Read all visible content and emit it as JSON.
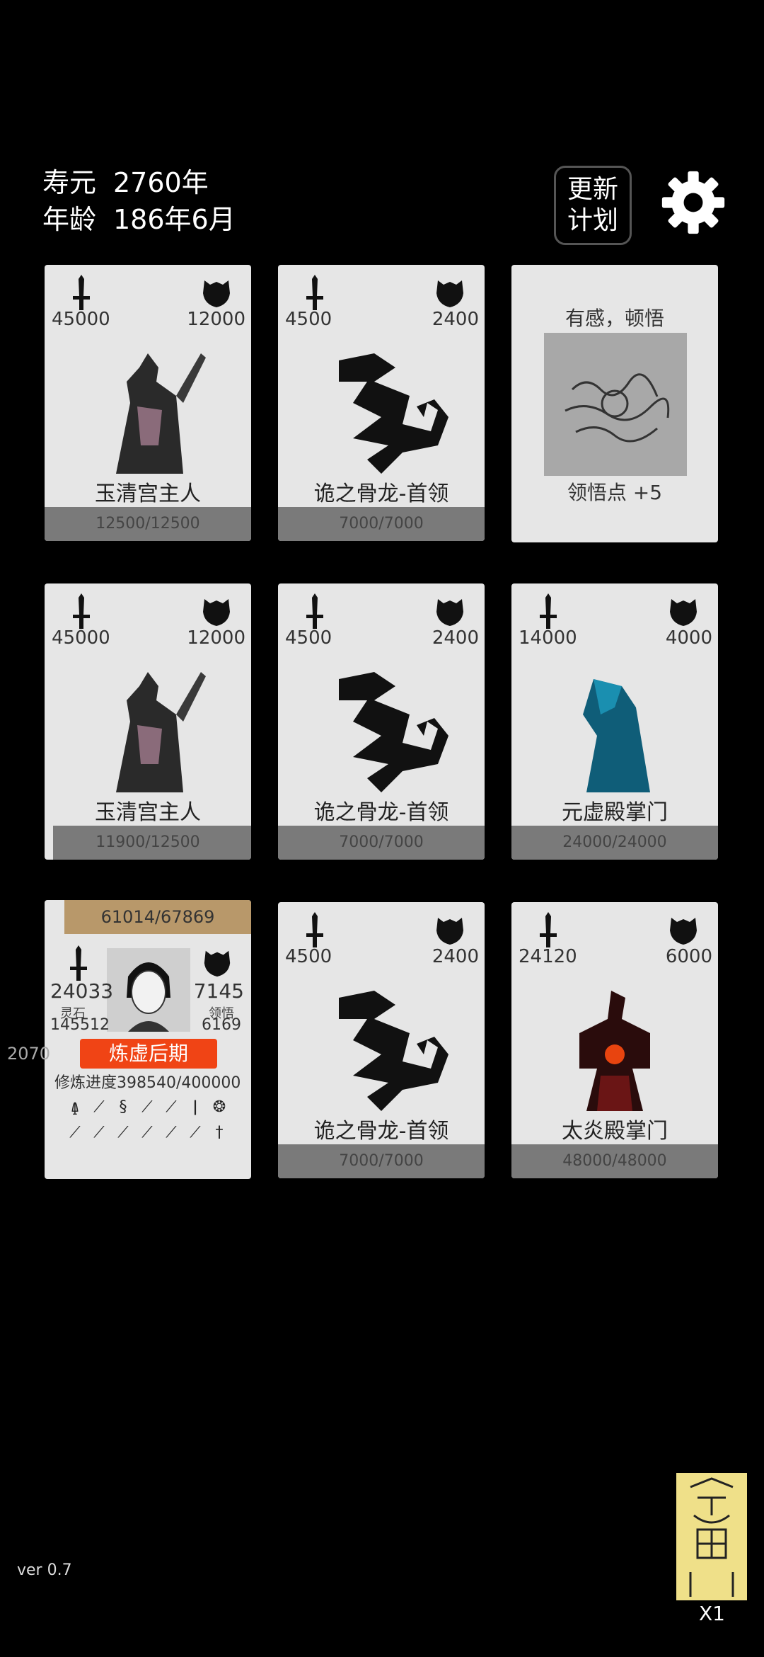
{
  "stats": {
    "lifespan_label": "寿元",
    "lifespan_value": "2760年",
    "age_label": "年龄",
    "age_value": "186年6月"
  },
  "buttons": {
    "update_plan_line1": "更新",
    "update_plan_line2": "计划"
  },
  "cards": [
    {
      "atk": "45000",
      "def": "12000",
      "name": "玉清宫主人",
      "hp": "12500/12500",
      "hp_fraction": 1.0,
      "art": "robed-master"
    },
    {
      "atk": "4500",
      "def": "2400",
      "name": "诡之骨龙-首领",
      "hp": "7000/7000",
      "hp_fraction": 1.0,
      "art": "dragon"
    },
    {
      "event_title": "有感，顿悟",
      "event_bonus": "领悟点  +5"
    },
    {
      "atk": "45000",
      "def": "12000",
      "name": "玉清宫主人",
      "hp": "11900/12500",
      "hp_fraction": 0.952,
      "art": "robed-master"
    },
    {
      "atk": "4500",
      "def": "2400",
      "name": "诡之骨龙-首领",
      "hp": "7000/7000",
      "hp_fraction": 1.0,
      "art": "dragon"
    },
    {
      "atk": "14000",
      "def": "4000",
      "name": "元虚殿掌门",
      "hp": "24000/24000",
      "hp_fraction": 1.0,
      "art": "blue-sect-master"
    },
    {
      "atk": "4500",
      "def": "2400",
      "name": "诡之骨龙-首领",
      "hp": "7000/7000",
      "hp_fraction": 1.0,
      "art": "dragon"
    },
    {
      "atk": "24120",
      "def": "6000",
      "name": "太炎殿掌门",
      "hp": "48000/48000",
      "hp_fraction": 1.0,
      "art": "flame-sect-master"
    }
  ],
  "player": {
    "exp": "61014/67869",
    "atk": "24033",
    "def": "7145",
    "spirit_stone_label": "灵石",
    "spirit_stone_value": "145512",
    "insight_label": "领悟",
    "insight_value": "6169",
    "realm": "炼虚后期",
    "progress_label": "修炼进度",
    "progress_value": "398540/400000",
    "weapons": [
      "axe",
      "spear",
      "scroll",
      "sword",
      "sword",
      "dagger",
      "lion",
      "spear",
      "sword",
      "sword",
      "sword",
      "sword",
      "sword",
      "cross"
    ]
  },
  "side_number": "2070",
  "version": "ver 0.7",
  "talisman": {
    "count": "X1",
    "icon": "thunder-talisman"
  },
  "colors": {
    "background": "#000000",
    "card": "#e6e6e6",
    "hp_bar": "#7a7a7a",
    "exp_bar": "#b8986a",
    "realm": "#f04415",
    "talisman": "#efe089"
  }
}
